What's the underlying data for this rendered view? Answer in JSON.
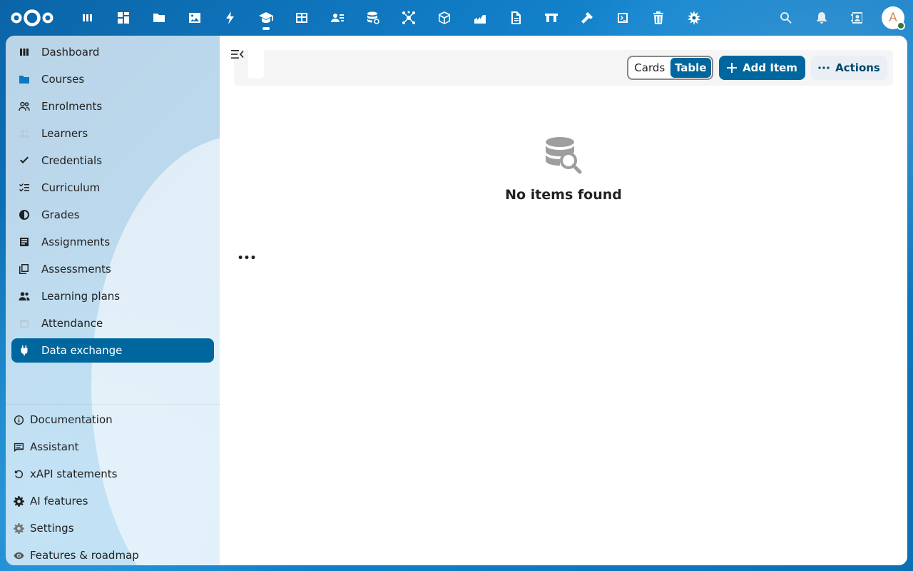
{
  "topbar": {
    "apps": [
      {
        "name": "dashboard-app",
        "icon": "dashboard-icon"
      },
      {
        "name": "widgets-app",
        "icon": "grid-icon"
      },
      {
        "name": "files-app",
        "icon": "folder-icon"
      },
      {
        "name": "photos-app",
        "icon": "image-icon"
      },
      {
        "name": "activity-app",
        "icon": "lightning-icon"
      },
      {
        "name": "learning-app",
        "icon": "graduation-cap-icon",
        "active": true
      },
      {
        "name": "tables-app",
        "icon": "table-icon"
      },
      {
        "name": "contacts-app",
        "icon": "contacts-icon"
      },
      {
        "name": "database-app",
        "icon": "database-icon"
      },
      {
        "name": "network-app",
        "icon": "network-icon"
      },
      {
        "name": "package-app",
        "icon": "cube-icon"
      },
      {
        "name": "workflow-app",
        "icon": "workflow-icon"
      },
      {
        "name": "notes-app",
        "icon": "document-icon"
      },
      {
        "name": "board-app",
        "icon": "board-icon"
      },
      {
        "name": "tools-app",
        "icon": "hammer-icon"
      },
      {
        "name": "code-app",
        "icon": "code-icon"
      },
      {
        "name": "trash-app",
        "icon": "trash-icon"
      },
      {
        "name": "custom-app",
        "icon": "star-gear-icon"
      }
    ],
    "avatar_initial": "A"
  },
  "sidebar": {
    "items": [
      {
        "label": "Dashboard",
        "icon": "dashboard-icon"
      },
      {
        "label": "Courses",
        "icon": "folder-icon"
      },
      {
        "label": "Enrolments",
        "icon": "people-icon"
      },
      {
        "label": "Learners",
        "icon": "learners-icon"
      },
      {
        "label": "Credentials",
        "icon": "check-icon"
      },
      {
        "label": "Curriculum",
        "icon": "checklist-icon"
      },
      {
        "label": "Grades",
        "icon": "half-circle-icon"
      },
      {
        "label": "Assignments",
        "icon": "clipboard-icon"
      },
      {
        "label": "Assessments",
        "icon": "copy-icon"
      },
      {
        "label": "Learning plans",
        "icon": "group-icon"
      },
      {
        "label": "Attendance",
        "icon": "calendar-icon"
      },
      {
        "label": "Data exchange",
        "icon": "plug-icon",
        "active": true
      }
    ],
    "bottom": [
      {
        "label": "Documentation",
        "icon": "info-icon"
      },
      {
        "label": "Assistant",
        "icon": "chat-icon"
      },
      {
        "label": "xAPI statements",
        "icon": "history-icon"
      },
      {
        "label": "AI features",
        "icon": "gear-icon"
      },
      {
        "label": "Settings",
        "icon": "settings-icon"
      },
      {
        "label": "Features & roadmap",
        "icon": "eye-icon"
      }
    ]
  },
  "toolbar": {
    "view_cards": "Cards",
    "view_table": "Table",
    "add_item": "Add Item",
    "actions": "Actions"
  },
  "empty": {
    "title": "No items found"
  },
  "more": "•••"
}
